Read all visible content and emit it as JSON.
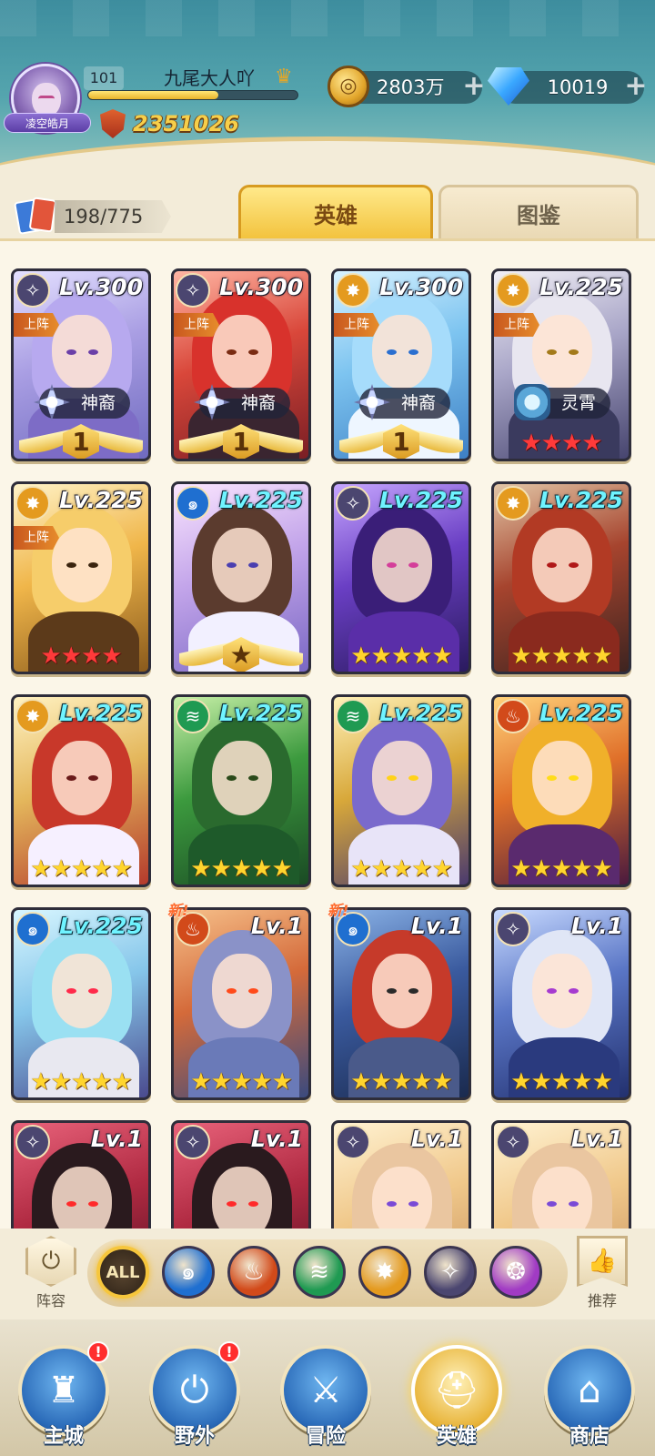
{
  "player": {
    "level": "101",
    "name": "九尾大人吖",
    "title": "凌空皓月",
    "power": "2351026",
    "exp_fraction": 0.62,
    "vip_icon": "crown-icon"
  },
  "resources": {
    "gold": "2803万",
    "gems": "10019",
    "add_label": "+"
  },
  "collection": {
    "count": "198/775"
  },
  "tabs": [
    {
      "label": "英雄",
      "active": true
    },
    {
      "label": "图鉴",
      "active": false
    }
  ],
  "heroes": [
    {
      "level": "Lv.300",
      "faction": "void",
      "deployed": true,
      "deploy_label": "上阵",
      "rank": "神裔",
      "wing_number": "1",
      "lv_color": "white",
      "art": "lavender"
    },
    {
      "level": "Lv.300",
      "faction": "void",
      "deployed": true,
      "deploy_label": "上阵",
      "rank": "神裔",
      "wing_number": "1",
      "lv_color": "white",
      "art": "crimson"
    },
    {
      "level": "Lv.300",
      "faction": "light",
      "deployed": true,
      "deploy_label": "上阵",
      "rank": "神裔",
      "wing_number": "1",
      "lv_color": "white",
      "art": "icy"
    },
    {
      "level": "Lv.225",
      "faction": "light",
      "deployed": true,
      "deploy_label": "上阵",
      "rank": "灵霄",
      "stars": "★★★★",
      "star_color": "red",
      "lv_color": "white",
      "art": "silver"
    },
    {
      "level": "Lv.225",
      "faction": "light",
      "deployed": true,
      "deploy_label": "上阵",
      "stars": "★★★★",
      "star_color": "red",
      "lv_color": "white",
      "art": "golden"
    },
    {
      "level": "Lv.225",
      "faction": "water",
      "deployed": false,
      "wing_star": "★",
      "lv_color": "cyan",
      "art": "brunette"
    },
    {
      "level": "Lv.225",
      "faction": "void",
      "deployed": false,
      "stars": "★★★★★",
      "star_color": "gold",
      "lv_color": "cyan",
      "art": "violet"
    },
    {
      "level": "Lv.225",
      "faction": "light",
      "deployed": false,
      "stars": "★★★★★",
      "star_color": "gold",
      "lv_color": "cyan",
      "art": "hood-red"
    },
    {
      "level": "Lv.225",
      "faction": "light",
      "deployed": false,
      "stars": "★★★★★",
      "star_color": "gold",
      "lv_color": "cyan",
      "art": "helm-red"
    },
    {
      "level": "Lv.225",
      "faction": "wind",
      "deployed": false,
      "stars": "★★★★★",
      "star_color": "gold",
      "lv_color": "cyan",
      "art": "forest"
    },
    {
      "level": "Lv.225",
      "faction": "wind",
      "deployed": false,
      "stars": "★★★★★",
      "star_color": "gold",
      "lv_color": "cyan",
      "art": "beast"
    },
    {
      "level": "Lv.225",
      "faction": "fire",
      "deployed": false,
      "stars": "★★★★★",
      "star_color": "gold",
      "lv_color": "cyan",
      "art": "demon"
    },
    {
      "level": "Lv.225",
      "faction": "water",
      "deployed": false,
      "stars": "★★★★★",
      "star_color": "gold",
      "lv_color": "cyan",
      "art": "ninja"
    },
    {
      "level": "Lv.1",
      "faction": "fire",
      "deployed": false,
      "is_new": true,
      "new_label": "新!",
      "stars": "★★★★★",
      "star_color": "gold",
      "lv_color": "white",
      "art": "troll"
    },
    {
      "level": "Lv.1",
      "faction": "water",
      "deployed": false,
      "is_new": true,
      "new_label": "新!",
      "stars": "★★★★★",
      "star_color": "gold",
      "lv_color": "white",
      "art": "dwarf"
    },
    {
      "level": "Lv.1",
      "faction": "void",
      "deployed": false,
      "stars": "★★★★★",
      "star_color": "gold",
      "lv_color": "white",
      "art": "mystic"
    },
    {
      "level": "Lv.1",
      "faction": "void",
      "deployed": false,
      "lv_color": "white",
      "art": "skull"
    },
    {
      "level": "Lv.1",
      "faction": "void",
      "deployed": false,
      "lv_color": "white",
      "art": "skull"
    },
    {
      "level": "Lv.1",
      "faction": "void",
      "deployed": false,
      "lv_color": "white",
      "art": "robot"
    },
    {
      "level": "Lv.1",
      "faction": "void",
      "deployed": false,
      "lv_color": "white",
      "art": "robot"
    }
  ],
  "factions": {
    "void": {
      "icon": "void-faction-icon",
      "glyph": "✧",
      "color": "#4b4670"
    },
    "light": {
      "icon": "light-faction-icon",
      "glyph": "✸",
      "color": "#e49a1f"
    },
    "water": {
      "icon": "water-faction-icon",
      "glyph": "๑",
      "color": "#1f6fd0"
    },
    "wind": {
      "icon": "wind-faction-icon",
      "glyph": "≋",
      "color": "#1f9a52"
    },
    "fire": {
      "icon": "fire-faction-icon",
      "glyph": "♨",
      "color": "#d24a1a"
    }
  },
  "filter": {
    "lineup_label": "阵容",
    "recommend_label": "推荐",
    "all_label": "ALL",
    "buttons": [
      {
        "name": "all",
        "label": "ALL"
      },
      {
        "name": "water",
        "glyph": "๑",
        "color": "#1f6fd0"
      },
      {
        "name": "fire",
        "glyph": "♨",
        "color": "#d24a1a"
      },
      {
        "name": "wind",
        "glyph": "≋",
        "color": "#1f9a52"
      },
      {
        "name": "light",
        "glyph": "✸",
        "color": "#e49a1f"
      },
      {
        "name": "void",
        "glyph": "✧",
        "color": "#4b4670"
      },
      {
        "name": "arcane",
        "glyph": "❂",
        "color": "#a13bc4"
      }
    ]
  },
  "nav": [
    {
      "name": "main-city",
      "label": "主城",
      "glyph": "♜",
      "badge": "!"
    },
    {
      "name": "wild",
      "label": "野外",
      "glyph": "⏻",
      "badge": "!"
    },
    {
      "name": "adventure",
      "label": "冒险",
      "glyph": "⚔"
    },
    {
      "name": "heroes",
      "label": "英雄",
      "glyph": "⛑",
      "active": true
    },
    {
      "name": "shop",
      "label": "商店",
      "glyph": "⌂"
    }
  ]
}
